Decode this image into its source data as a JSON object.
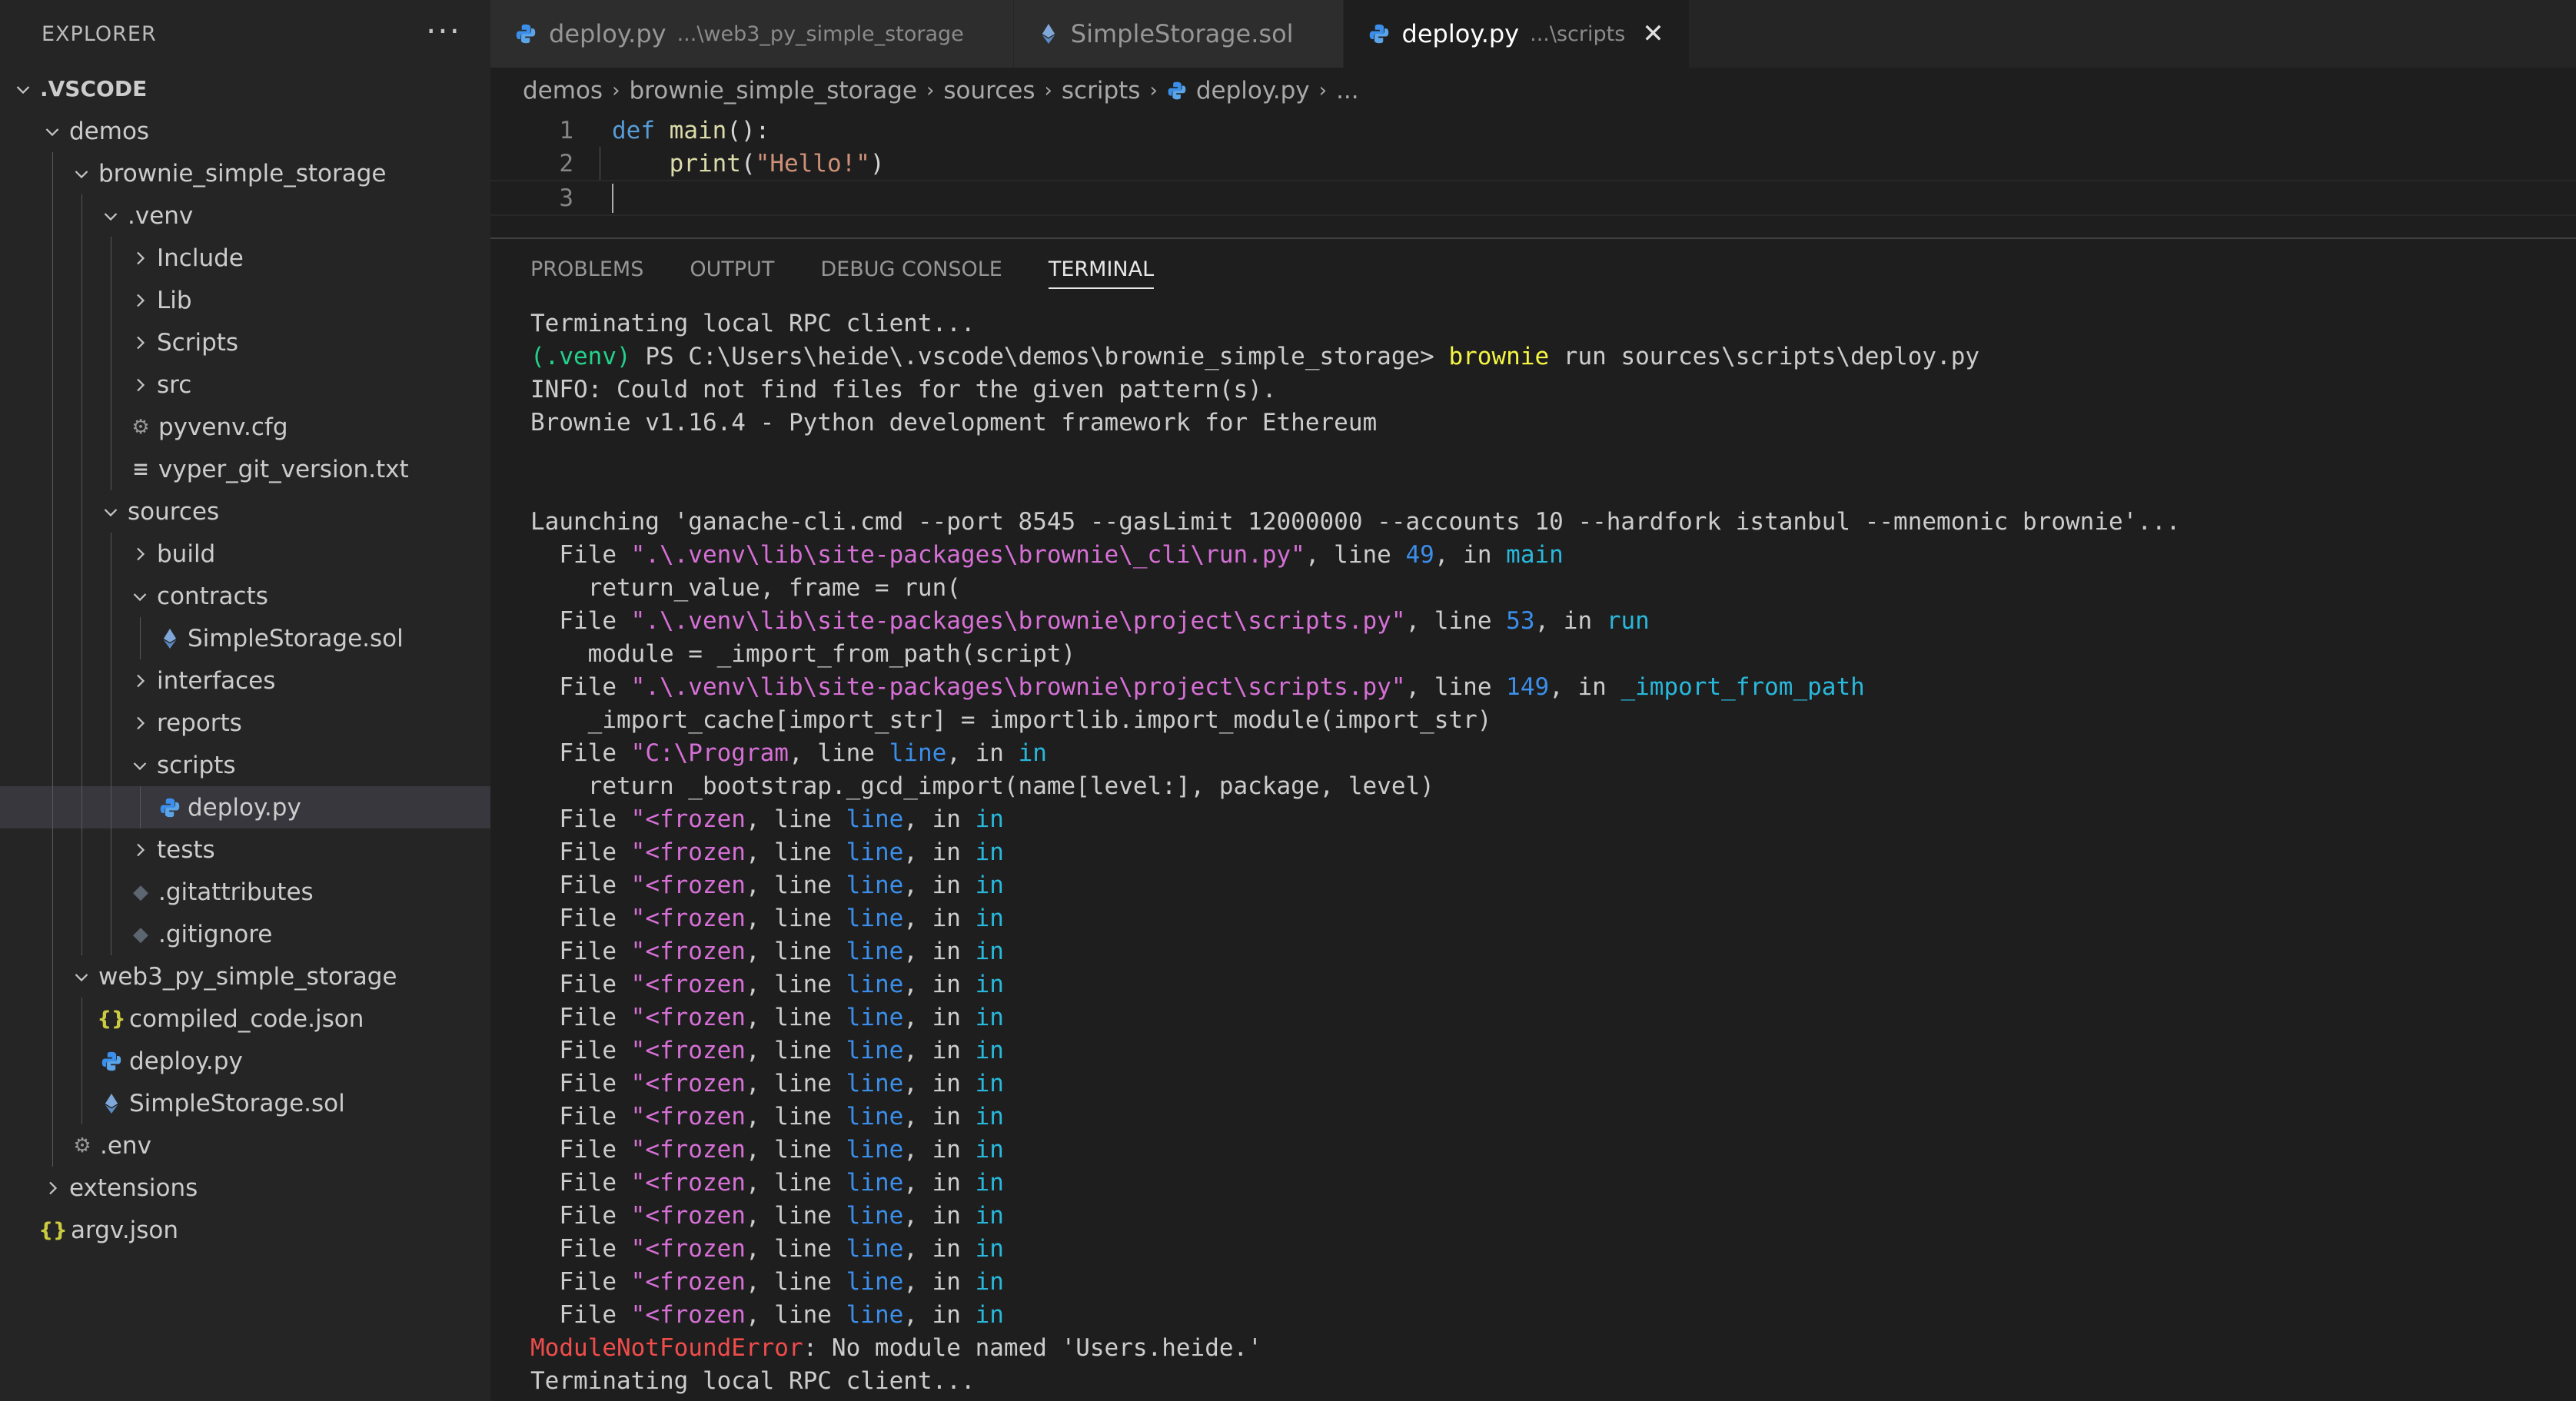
{
  "explorer": {
    "title": "EXPLORER",
    "more": "···",
    "tree": [
      {
        "label": ".VSCODE",
        "depth": 0,
        "kind": "folder-open",
        "root": true
      },
      {
        "label": "demos",
        "depth": 1,
        "kind": "folder-open"
      },
      {
        "label": "brownie_simple_storage",
        "depth": 2,
        "kind": "folder-open"
      },
      {
        "label": ".venv",
        "depth": 3,
        "kind": "folder-open"
      },
      {
        "label": "Include",
        "depth": 4,
        "kind": "folder"
      },
      {
        "label": "Lib",
        "depth": 4,
        "kind": "folder"
      },
      {
        "label": "Scripts",
        "depth": 4,
        "kind": "folder"
      },
      {
        "label": "src",
        "depth": 4,
        "kind": "folder"
      },
      {
        "label": "pyvenv.cfg",
        "depth": 4,
        "kind": "gear"
      },
      {
        "label": "vyper_git_version.txt",
        "depth": 4,
        "kind": "text"
      },
      {
        "label": "sources",
        "depth": 3,
        "kind": "folder-open"
      },
      {
        "label": "build",
        "depth": 4,
        "kind": "folder"
      },
      {
        "label": "contracts",
        "depth": 4,
        "kind": "folder-open"
      },
      {
        "label": "SimpleStorage.sol",
        "depth": 5,
        "kind": "eth"
      },
      {
        "label": "interfaces",
        "depth": 4,
        "kind": "folder"
      },
      {
        "label": "reports",
        "depth": 4,
        "kind": "folder"
      },
      {
        "label": "scripts",
        "depth": 4,
        "kind": "folder-open"
      },
      {
        "label": "deploy.py",
        "depth": 5,
        "kind": "python",
        "selected": true
      },
      {
        "label": "tests",
        "depth": 4,
        "kind": "folder"
      },
      {
        "label": ".gitattributes",
        "depth": 4,
        "kind": "git"
      },
      {
        "label": ".gitignore",
        "depth": 4,
        "kind": "git"
      },
      {
        "label": "web3_py_simple_storage",
        "depth": 2,
        "kind": "folder-open"
      },
      {
        "label": "compiled_code.json",
        "depth": 3,
        "kind": "json"
      },
      {
        "label": "deploy.py",
        "depth": 3,
        "kind": "python"
      },
      {
        "label": "SimpleStorage.sol",
        "depth": 3,
        "kind": "eth"
      },
      {
        "label": ".env",
        "depth": 2,
        "kind": "gear"
      },
      {
        "label": "extensions",
        "depth": 1,
        "kind": "folder"
      },
      {
        "label": "argv.json",
        "depth": 1,
        "kind": "json"
      }
    ]
  },
  "tabs": [
    {
      "label": "deploy.py",
      "desc": "...\\web3_py_simple_storage",
      "icon": "python-icon",
      "active": false
    },
    {
      "label": "SimpleStorage.sol",
      "desc": "",
      "icon": "ethereum-icon",
      "active": false
    },
    {
      "label": "deploy.py",
      "desc": "...\\scripts",
      "icon": "python-icon",
      "active": true,
      "close": "✕"
    }
  ],
  "breadcrumb": [
    "demos",
    "brownie_simple_storage",
    "sources",
    "scripts",
    "deploy.py",
    "..."
  ],
  "editor": {
    "lines": [
      {
        "n": "1",
        "tokens": [
          {
            "t": "def ",
            "c": "kw"
          },
          {
            "t": "main",
            "c": "fn"
          },
          {
            "t": "():",
            "c": ""
          }
        ]
      },
      {
        "n": "2",
        "tokens": [
          {
            "t": "    ",
            "c": ""
          },
          {
            "t": "print",
            "c": "fn"
          },
          {
            "t": "(",
            "c": ""
          },
          {
            "t": "\"Hello!\"",
            "c": "str"
          },
          {
            "t": ")",
            "c": ""
          }
        ]
      },
      {
        "n": "3",
        "tokens": []
      }
    ]
  },
  "panel_tabs": [
    {
      "label": "PROBLEMS",
      "active": false
    },
    {
      "label": "OUTPUT",
      "active": false
    },
    {
      "label": "DEBUG CONSOLE",
      "active": false
    },
    {
      "label": "TERMINAL",
      "active": true
    }
  ],
  "terminal": [
    [
      {
        "t": "Terminating local RPC client..."
      }
    ],
    [
      {
        "t": "(.venv)",
        "c": "t-green"
      },
      {
        "t": " PS C:\\Users\\heide\\.vscode\\demos\\brownie_simple_storage> "
      },
      {
        "t": "brownie",
        "c": "t-yellow"
      },
      {
        "t": " run sources\\scripts\\deploy.py"
      }
    ],
    [
      {
        "t": "INFO: Could not find files for the given pattern(s)."
      }
    ],
    [
      {
        "t": "Brownie v1.16.4 - Python development framework for Ethereum"
      }
    ],
    [
      {
        "t": ""
      }
    ],
    [
      {
        "t": ""
      }
    ],
    [
      {
        "t": "Launching 'ganache-cli.cmd --port 8545 --gasLimit 12000000 --accounts 10 --hardfork istanbul --mnemonic brownie'..."
      }
    ],
    [
      {
        "t": "  File "
      },
      {
        "t": "\".\\.venv\\lib\\site-packages\\brownie\\_cli\\run.py\"",
        "c": "t-magenta"
      },
      {
        "t": ", line "
      },
      {
        "t": "49",
        "c": "t-blue"
      },
      {
        "t": ", in "
      },
      {
        "t": "main",
        "c": "t-cyan"
      }
    ],
    [
      {
        "t": "    return_value, frame = run("
      }
    ],
    [
      {
        "t": "  File "
      },
      {
        "t": "\".\\.venv\\lib\\site-packages\\brownie\\project\\scripts.py\"",
        "c": "t-magenta"
      },
      {
        "t": ", line "
      },
      {
        "t": "53",
        "c": "t-blue"
      },
      {
        "t": ", in "
      },
      {
        "t": "run",
        "c": "t-cyan"
      }
    ],
    [
      {
        "t": "    module = _import_from_path(script)"
      }
    ],
    [
      {
        "t": "  File "
      },
      {
        "t": "\".\\.venv\\lib\\site-packages\\brownie\\project\\scripts.py\"",
        "c": "t-magenta"
      },
      {
        "t": ", line "
      },
      {
        "t": "149",
        "c": "t-blue"
      },
      {
        "t": ", in "
      },
      {
        "t": "_import_from_path",
        "c": "t-cyan"
      }
    ],
    [
      {
        "t": "    _import_cache[import_str] = importlib.import_module(import_str)"
      }
    ],
    [
      {
        "t": "  File "
      },
      {
        "t": "\"C:\\Program",
        "c": "t-magenta"
      },
      {
        "t": ", line "
      },
      {
        "t": "line",
        "c": "t-blue"
      },
      {
        "t": ", in "
      },
      {
        "t": "in",
        "c": "t-cyan"
      }
    ],
    [
      {
        "t": "    return _bootstrap._gcd_import(name[level:], package, level)"
      }
    ],
    [
      {
        "t": "  File "
      },
      {
        "t": "\"<frozen",
        "c": "t-magenta"
      },
      {
        "t": ", line "
      },
      {
        "t": "line",
        "c": "t-blue"
      },
      {
        "t": ", in "
      },
      {
        "t": "in",
        "c": "t-cyan"
      }
    ],
    [
      {
        "t": "  File "
      },
      {
        "t": "\"<frozen",
        "c": "t-magenta"
      },
      {
        "t": ", line "
      },
      {
        "t": "line",
        "c": "t-blue"
      },
      {
        "t": ", in "
      },
      {
        "t": "in",
        "c": "t-cyan"
      }
    ],
    [
      {
        "t": "  File "
      },
      {
        "t": "\"<frozen",
        "c": "t-magenta"
      },
      {
        "t": ", line "
      },
      {
        "t": "line",
        "c": "t-blue"
      },
      {
        "t": ", in "
      },
      {
        "t": "in",
        "c": "t-cyan"
      }
    ],
    [
      {
        "t": "  File "
      },
      {
        "t": "\"<frozen",
        "c": "t-magenta"
      },
      {
        "t": ", line "
      },
      {
        "t": "line",
        "c": "t-blue"
      },
      {
        "t": ", in "
      },
      {
        "t": "in",
        "c": "t-cyan"
      }
    ],
    [
      {
        "t": "  File "
      },
      {
        "t": "\"<frozen",
        "c": "t-magenta"
      },
      {
        "t": ", line "
      },
      {
        "t": "line",
        "c": "t-blue"
      },
      {
        "t": ", in "
      },
      {
        "t": "in",
        "c": "t-cyan"
      }
    ],
    [
      {
        "t": "  File "
      },
      {
        "t": "\"<frozen",
        "c": "t-magenta"
      },
      {
        "t": ", line "
      },
      {
        "t": "line",
        "c": "t-blue"
      },
      {
        "t": ", in "
      },
      {
        "t": "in",
        "c": "t-cyan"
      }
    ],
    [
      {
        "t": "  File "
      },
      {
        "t": "\"<frozen",
        "c": "t-magenta"
      },
      {
        "t": ", line "
      },
      {
        "t": "line",
        "c": "t-blue"
      },
      {
        "t": ", in "
      },
      {
        "t": "in",
        "c": "t-cyan"
      }
    ],
    [
      {
        "t": "  File "
      },
      {
        "t": "\"<frozen",
        "c": "t-magenta"
      },
      {
        "t": ", line "
      },
      {
        "t": "line",
        "c": "t-blue"
      },
      {
        "t": ", in "
      },
      {
        "t": "in",
        "c": "t-cyan"
      }
    ],
    [
      {
        "t": "  File "
      },
      {
        "t": "\"<frozen",
        "c": "t-magenta"
      },
      {
        "t": ", line "
      },
      {
        "t": "line",
        "c": "t-blue"
      },
      {
        "t": ", in "
      },
      {
        "t": "in",
        "c": "t-cyan"
      }
    ],
    [
      {
        "t": "  File "
      },
      {
        "t": "\"<frozen",
        "c": "t-magenta"
      },
      {
        "t": ", line "
      },
      {
        "t": "line",
        "c": "t-blue"
      },
      {
        "t": ", in "
      },
      {
        "t": "in",
        "c": "t-cyan"
      }
    ],
    [
      {
        "t": "  File "
      },
      {
        "t": "\"<frozen",
        "c": "t-magenta"
      },
      {
        "t": ", line "
      },
      {
        "t": "line",
        "c": "t-blue"
      },
      {
        "t": ", in "
      },
      {
        "t": "in",
        "c": "t-cyan"
      }
    ],
    [
      {
        "t": "  File "
      },
      {
        "t": "\"<frozen",
        "c": "t-magenta"
      },
      {
        "t": ", line "
      },
      {
        "t": "line",
        "c": "t-blue"
      },
      {
        "t": ", in "
      },
      {
        "t": "in",
        "c": "t-cyan"
      }
    ],
    [
      {
        "t": "  File "
      },
      {
        "t": "\"<frozen",
        "c": "t-magenta"
      },
      {
        "t": ", line "
      },
      {
        "t": "line",
        "c": "t-blue"
      },
      {
        "t": ", in "
      },
      {
        "t": "in",
        "c": "t-cyan"
      }
    ],
    [
      {
        "t": "  File "
      },
      {
        "t": "\"<frozen",
        "c": "t-magenta"
      },
      {
        "t": ", line "
      },
      {
        "t": "line",
        "c": "t-blue"
      },
      {
        "t": ", in "
      },
      {
        "t": "in",
        "c": "t-cyan"
      }
    ],
    [
      {
        "t": "  File "
      },
      {
        "t": "\"<frozen",
        "c": "t-magenta"
      },
      {
        "t": ", line "
      },
      {
        "t": "line",
        "c": "t-blue"
      },
      {
        "t": ", in "
      },
      {
        "t": "in",
        "c": "t-cyan"
      }
    ],
    [
      {
        "t": "  File "
      },
      {
        "t": "\"<frozen",
        "c": "t-magenta"
      },
      {
        "t": ", line "
      },
      {
        "t": "line",
        "c": "t-blue"
      },
      {
        "t": ", in "
      },
      {
        "t": "in",
        "c": "t-cyan"
      }
    ],
    [
      {
        "t": "ModuleNotFoundError",
        "c": "t-red"
      },
      {
        "t": ": No module named 'Users.heide.'"
      }
    ],
    [
      {
        "t": "Terminating local RPC client..."
      }
    ]
  ]
}
